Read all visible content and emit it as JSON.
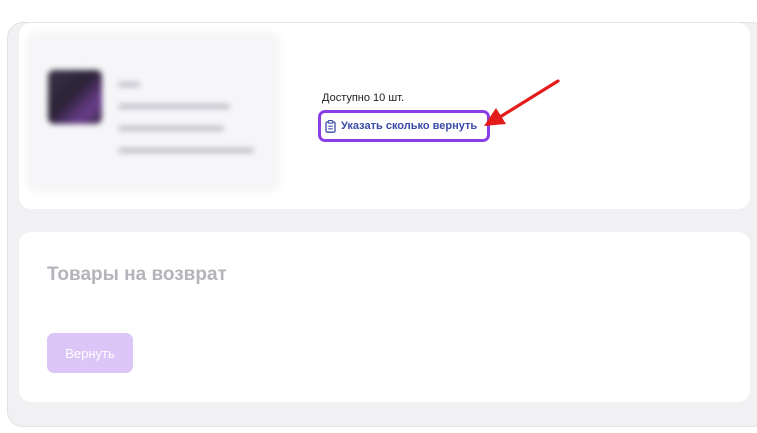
{
  "product": {
    "available_text": "Доступно 10 шт.",
    "specify_return_label": "Указать сколько вернуть",
    "specify_icon": "clipboard-icon",
    "thumbnail_icon": "product-thumbnail"
  },
  "return_section": {
    "title": "Товары на возврат",
    "return_button_label": "Вернуть"
  },
  "colors": {
    "accent_purple": "#8a3ee6",
    "link_blue": "#3b4aa8",
    "button_disabled": "#dcc5f7",
    "annotation_arrow": "#e41b1b"
  }
}
